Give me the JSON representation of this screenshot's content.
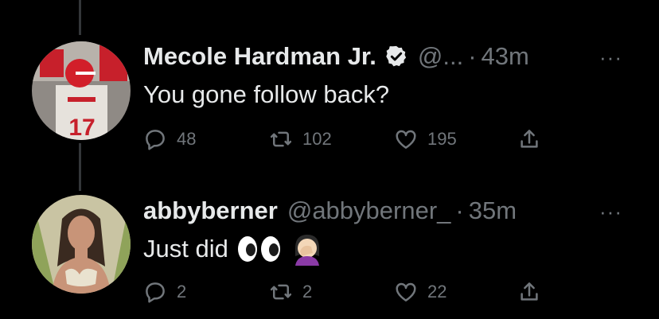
{
  "tweets": [
    {
      "author_name": "Mecole Hardman Jr.",
      "verified": true,
      "handle": "@...",
      "separator": "·",
      "time": "43m",
      "text": "You gone follow back?",
      "emoji": [],
      "replies": "48",
      "retweets": "102",
      "likes": "195"
    },
    {
      "author_name": "abbyberner",
      "verified": false,
      "handle": "@abbyberner_",
      "separator": "·",
      "time": "35m",
      "text": "Just did",
      "emoji": [
        "eyes-emoji",
        "facepalm-emoji"
      ],
      "replies": "2",
      "retweets": "2",
      "likes": "22"
    }
  ],
  "more_label": "···",
  "colors": {
    "background": "#000000",
    "primary_text": "#e7e9ea",
    "secondary_text": "#71767b",
    "thread_line": "#333639",
    "verified_badge": "#e7e9ea"
  }
}
